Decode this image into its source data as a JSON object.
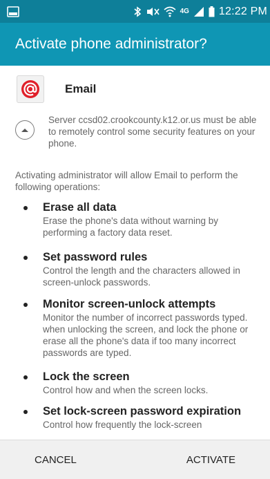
{
  "status_bar": {
    "time": "12:22 PM",
    "left_icon": "gallery-notification-icon",
    "icons": [
      "bluetooth-icon",
      "mute-icon",
      "wifi-icon",
      "lte-icon",
      "signal-icon",
      "battery-icon"
    ],
    "lte_label": "4G",
    "colors": {
      "background": "#0e7f99",
      "foreground": "#ffffff"
    }
  },
  "title_bar": {
    "title": "Activate phone administrator?",
    "color": "#0f96b4"
  },
  "app": {
    "name": "Email",
    "icon": "email-at-icon",
    "icon_color": "#e0202a"
  },
  "server_notice": {
    "text": "Server ccsd02.crookcounty.k12.or.us must be able to remotely control some security features on your phone."
  },
  "intro_text": "Activating administrator will allow Email to perform the following operations:",
  "operations": [
    {
      "title": "Erase all data",
      "description": "Erase the phone's data without warning by performing a factory data reset."
    },
    {
      "title": "Set password rules",
      "description": "Control the length and the characters allowed in screen-unlock passwords."
    },
    {
      "title": "Monitor screen-unlock attempts",
      "description": "Monitor the number of incorrect passwords typed. when unlocking the screen, and lock the phone or erase all the phone's data if too many incorrect passwords are typed."
    },
    {
      "title": "Lock the screen",
      "description": "Control how and when the screen locks."
    },
    {
      "title": "Set lock-screen password expiration",
      "description": "Control how frequently the lock-screen"
    }
  ],
  "buttons": {
    "cancel": "CANCEL",
    "activate": "ACTIVATE"
  }
}
